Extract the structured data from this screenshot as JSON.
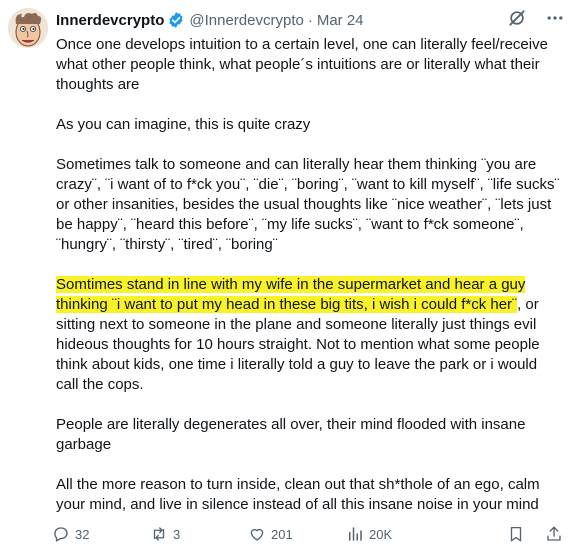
{
  "author": {
    "display_name": "Innerdevcrypto",
    "handle": "@Innerdevcrypto",
    "separator": "·",
    "date": "Mar 24"
  },
  "tweet": {
    "p1": "Once one develops intuition to a certain level, one can literally feel/receive what other people think, what people´s intuitions are or literally what their thoughts are",
    "p2": "As you can imagine, this is quite crazy",
    "p3": "Sometimes talk to someone and can literally hear them thinking ¨you are crazy¨, ¨i want of to f*ck you¨, ¨die¨, ¨boring¨, ¨want to kill myself¨, ¨life sucks¨ or other insanities, besides the usual thoughts like ¨nice weather¨, ¨lets just be happy¨, ¨heard this before¨, ¨my life sucks¨, ¨want to f*ck someone¨, ¨hungry¨, ¨thirsty¨, ¨tired¨, ¨boring¨",
    "p4_highlighted": "Somtimes stand in line with my wife in the supermarket and hear a guy thinking ¨i want to put my head in these big tits, i wish i could f*ck her¨",
    "p4_rest": ", or sitting next to someone in the plane and someone literally just things evil hideous thoughts for 10 hours straight. Not to mention what some people think about kids, one time i literally told a guy to leave the park or i would call the cops.",
    "p5": "People are literally degenerates all over, their mind flooded with insane garbage",
    "p6": "All the more reason to turn inside, clean out that sh*thole of an ego, calm your mind, and live in silence instead of all this insane noise in your mind"
  },
  "stats": {
    "replies": "32",
    "reposts": "3",
    "likes": "201",
    "views": "20K"
  },
  "colors": {
    "text": "#0f1419",
    "secondary": "#536471",
    "highlight": "#f8f227",
    "verified": "#1d9bf0"
  },
  "icons": [
    "grok-icon",
    "more-icon",
    "verified-badge-icon",
    "reply-icon",
    "repost-icon",
    "like-icon",
    "views-icon",
    "bookmark-icon",
    "share-icon"
  ]
}
